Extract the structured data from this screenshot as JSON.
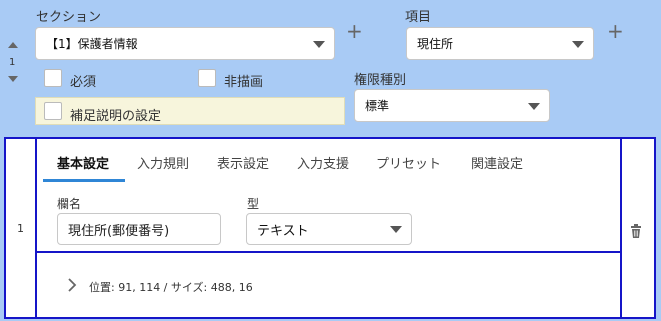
{
  "section": {
    "label": "セクション",
    "value": "【1】保護者情報"
  },
  "item": {
    "label": "項目",
    "value": "現住所"
  },
  "row_number": "1",
  "checkboxes": {
    "required": "必須",
    "no_render": "非描画",
    "supplement": "補足説明の設定"
  },
  "permission": {
    "label": "権限種別",
    "value": "標準"
  },
  "tabs": [
    "基本設定",
    "入力規則",
    "表示設定",
    "入力支援",
    "プリセット",
    "関連設定"
  ],
  "fields": {
    "column_name": {
      "label": "欄名",
      "value": "現住所(郵便番号)"
    },
    "type": {
      "label": "型",
      "value": "テキスト"
    }
  },
  "position_info": "位置: 91, 114 / サイズ: 488, 16",
  "icons": {
    "plus": "+",
    "trash": "trash-icon"
  }
}
